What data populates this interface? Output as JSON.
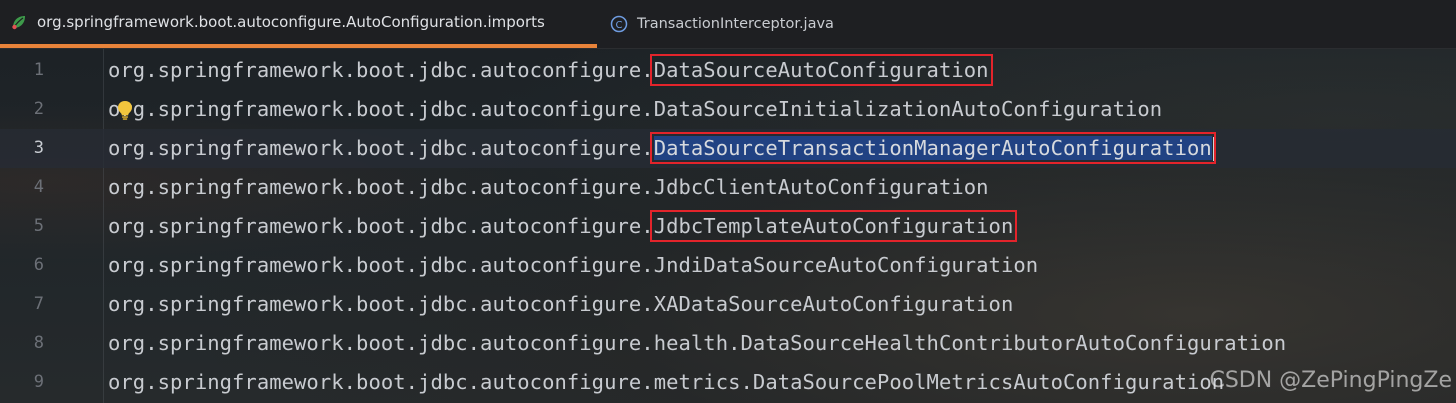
{
  "tabs": [
    {
      "label": "org.springframework.boot.autoconfigure.AutoConfiguration.imports",
      "active": true,
      "icon": "spring-leaf-icon"
    },
    {
      "label": "TransactionInterceptor.java",
      "active": false,
      "icon": "java-class-icon"
    }
  ],
  "editor": {
    "current_line": 3,
    "lines": [
      {
        "number": "1",
        "prefix": "org.springframework.boot.jdbc.autoconfigure.",
        "name": "DataSourceAutoConfiguration"
      },
      {
        "number": "2",
        "prefix": "org.springframework.boot.jdbc.autoconfigure.",
        "name": "DataSourceInitializationAutoConfiguration"
      },
      {
        "number": "3",
        "prefix": "org.springframework.boot.jdbc.autoconfigure.",
        "name": "DataSourceTransactionManagerAutoConfiguration"
      },
      {
        "number": "4",
        "prefix": "org.springframework.boot.jdbc.autoconfigure.",
        "name": "JdbcClientAutoConfiguration"
      },
      {
        "number": "5",
        "prefix": "org.springframework.boot.jdbc.autoconfigure.",
        "name": "JdbcTemplateAutoConfiguration"
      },
      {
        "number": "6",
        "prefix": "org.springframework.boot.jdbc.autoconfigure.",
        "name": "JndiDataSourceAutoConfiguration"
      },
      {
        "number": "7",
        "prefix": "org.springframework.boot.jdbc.autoconfigure.",
        "name": "XADataSourceAutoConfiguration"
      },
      {
        "number": "8",
        "prefix": "org.springframework.boot.jdbc.autoconfigure.",
        "name": "health.DataSourceHealthContributorAutoConfiguration"
      },
      {
        "number": "9",
        "prefix": "org.springframework.boot.jdbc.autoconfigure.",
        "name": "metrics.DataSourcePoolMetricsAutoConfiguration"
      }
    ],
    "highlighted_lines": [
      1,
      3,
      5
    ],
    "selected_line": 3,
    "intention_icon": "lightbulb-icon"
  },
  "watermark": "CSDN @ZePingPingZe",
  "colors": {
    "accent_tab_underline": "#e8833a",
    "annotation_box": "#e3242b",
    "selection": "#214283",
    "code_text": "#c8cbd0",
    "line_number": "#6c7077"
  }
}
